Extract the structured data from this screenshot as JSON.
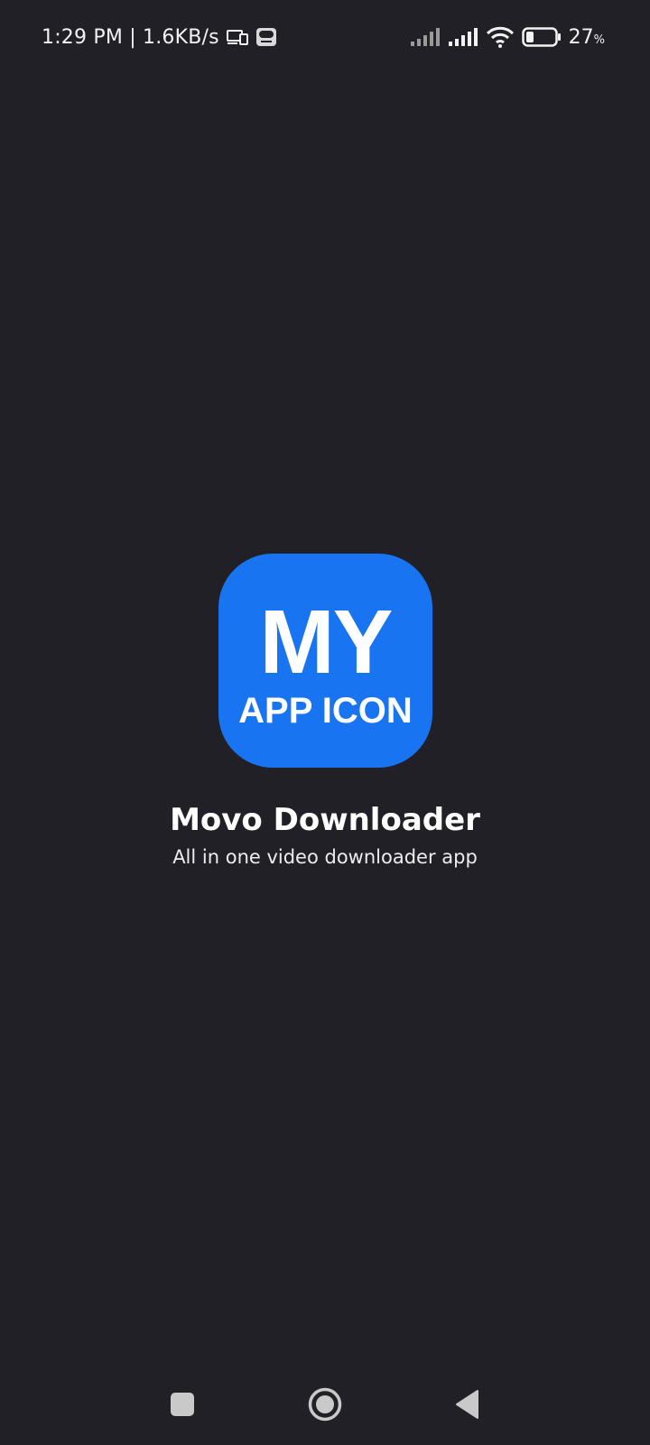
{
  "status_bar": {
    "time_speed": "1:29 PM | 1.6KB/s",
    "battery_percent": "27",
    "battery_unit": "%",
    "battery_level": 0.27,
    "icons": [
      "cast-screen-icon",
      "notification-badge-icon",
      "signal-weak-icon",
      "signal-full-icon",
      "wifi-icon",
      "battery-icon"
    ]
  },
  "splash": {
    "icon_line1": "MY",
    "icon_line2": "APP ICON",
    "icon_color": "#1974f2",
    "app_name": "Movo Downloader",
    "tagline": "All in one video downloader app"
  },
  "nav_bar": {
    "buttons": [
      "recents-button",
      "home-button",
      "back-button"
    ]
  },
  "colors": {
    "background": "#212027",
    "text": "#ffffff"
  }
}
